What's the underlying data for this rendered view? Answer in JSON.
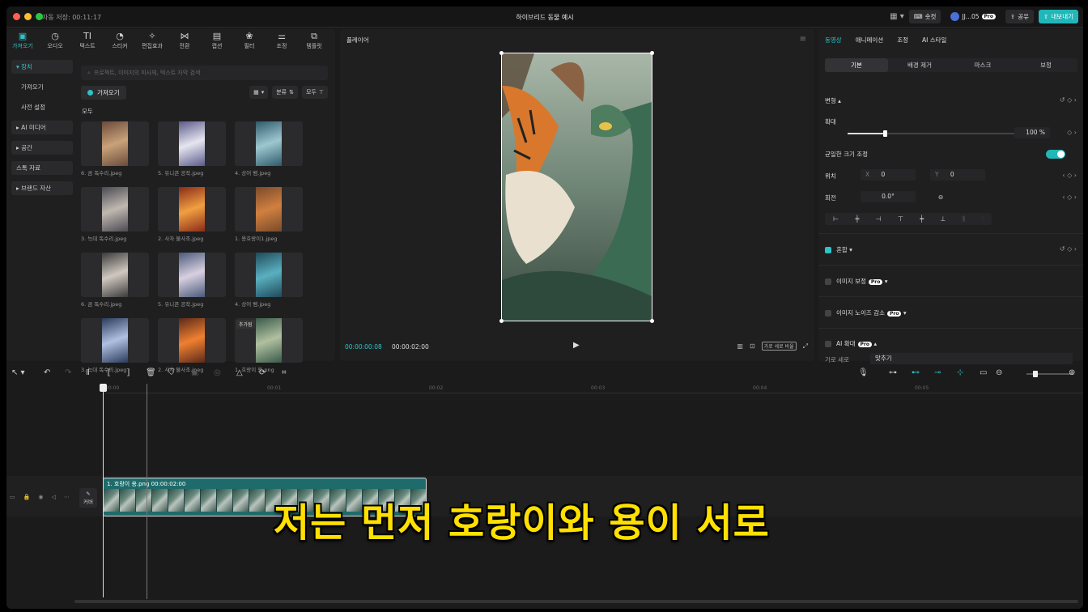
{
  "titlebar": {
    "autosave": "자동 저장: 00:11:17",
    "title": "하이브리드 동물 예시",
    "shortcuts": "숏컷",
    "user": "JJ...05",
    "pro": "Pro",
    "share": "공유",
    "export": "내보내기"
  },
  "toolbar": [
    {
      "label": "가져오기",
      "icon": "▣"
    },
    {
      "label": "오디오",
      "icon": "◷"
    },
    {
      "label": "텍스트",
      "icon": "TI"
    },
    {
      "label": "스티커",
      "icon": "◔"
    },
    {
      "label": "편집효과",
      "icon": "✧"
    },
    {
      "label": "전환",
      "icon": "⋈"
    },
    {
      "label": "캡션",
      "icon": "▤"
    },
    {
      "label": "필터",
      "icon": "❀"
    },
    {
      "label": "조정",
      "icon": "⚌"
    },
    {
      "label": "템플릿",
      "icon": "⧉"
    }
  ],
  "sidenav": {
    "device": "▾ 장치",
    "import": "가져오기",
    "presets": "사전 설정",
    "ai_media": "▸ AI 미디어",
    "space": "▸ 공간",
    "stock": "스톡 자료",
    "brand": "▸ 브랜드 자산"
  },
  "media": {
    "search_placeholder": "프로젝트, 이미지의 피사체, 텍스트 자막 검색",
    "import_button": "가져오기",
    "sort": "분류",
    "filter_all": "모두",
    "all_label": "모두",
    "added_tag": "추가됨",
    "items": [
      {
        "name": "6. 곰 독수리.jpeg"
      },
      {
        "name": "5. 유니콘 공작.jpeg"
      },
      {
        "name": "4. 상어 뱀.jpeg"
      },
      {
        "name": "3. 늑대 독수리.jpeg"
      },
      {
        "name": "2. 사자 불사조.jpeg"
      },
      {
        "name": "1. 용호랑이1.jpeg"
      },
      {
        "name": "6. 곰 독수리.jpeg"
      },
      {
        "name": "5. 유니콘 공작.jpeg"
      },
      {
        "name": "4. 상어 뱀.jpeg"
      },
      {
        "name": "3. 늑대 독수리.jpeg"
      },
      {
        "name": "2. 사자 불사조.jpeg"
      },
      {
        "name": "1. 호랑이 용.png"
      }
    ]
  },
  "player": {
    "title": "플레이어",
    "current_time": "00:00:00:08",
    "total_time": "00:00:02:00",
    "ratio": "가로 세로 비율"
  },
  "inspector": {
    "tabs": [
      "동영상",
      "애니메이션",
      "조정",
      "AI 스타일"
    ],
    "subtabs": [
      "기본",
      "배경 제거",
      "마스크",
      "보정"
    ],
    "transform": "변형 ▴",
    "scale": "확대",
    "scale_value": "100 %",
    "uniform_scale": "균일한 크기 조정",
    "position": "위치",
    "pos_x_label": "X",
    "pos_x": "0",
    "pos_y_label": "Y",
    "pos_y": "0",
    "rotation": "회전",
    "rotation_value": "0.0°",
    "blend": "혼합 ▾",
    "image_correction": "이미지 보정",
    "noise_reduction": "이미지 노이즈 감소",
    "ai_upscale": "AI 확대",
    "aspect_label": "가로 세로",
    "aspect_value": "맞추기",
    "pro": "Pro"
  },
  "timeline": {
    "ruler": [
      "00:00",
      "00:01",
      "00:02",
      "00:03",
      "00:04",
      "00:05"
    ],
    "clip_title": "1. 호랑이 용.png   00:00:02:00",
    "cover": "커버"
  },
  "subtitle": "저는 먼저 호랑이와 용이 서로",
  "colors": {
    "accent": "#2ec3c6",
    "subtitle": "#ffe000"
  }
}
